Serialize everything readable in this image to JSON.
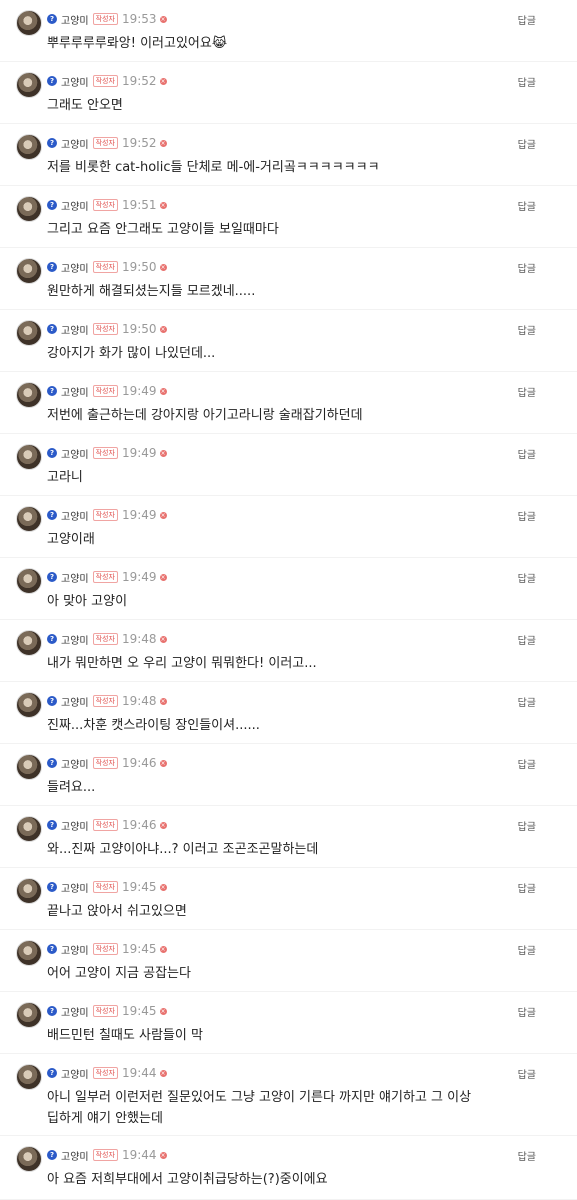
{
  "nickname": "고양미",
  "writer_badge": "작성자",
  "reply_label": "답글",
  "verified_glyph": "?",
  "delete_glyph": "×",
  "comments": [
    {
      "time": "19:53",
      "text": "뿌루루루루롸앙! 이러고있어요😹"
    },
    {
      "time": "19:52",
      "text": "그래도 안오면"
    },
    {
      "time": "19:52",
      "text": "저를 비롯한 cat-holic들 단체로 메-에-거리곸ㅋㅋㅋㅋㅋㅋㅋ"
    },
    {
      "time": "19:51",
      "text": "그리고 요즘 안그래도 고양이들 보일때마다"
    },
    {
      "time": "19:50",
      "text": "원만하게 해결되셨는지들 모르겠네....."
    },
    {
      "time": "19:50",
      "text": "강아지가 화가 많이 나있던데..."
    },
    {
      "time": "19:49",
      "text": "저번에 출근하는데 강아지랑 아기고라니랑 술래잡기하던데"
    },
    {
      "time": "19:49",
      "text": "고라니"
    },
    {
      "time": "19:49",
      "text": "고양이래"
    },
    {
      "time": "19:49",
      "text": "아 맞아 고양이"
    },
    {
      "time": "19:48",
      "text": "내가 뭐만하면 오 우리 고양이 뭐뭐한다! 이러고..."
    },
    {
      "time": "19:48",
      "text": "진짜...차훈 캣스라이팅 장인들이셔......"
    },
    {
      "time": "19:46",
      "text": "들려요..."
    },
    {
      "time": "19:46",
      "text": "와...진짜 고양이아냐...? 이러고 조곤조곤말하는데"
    },
    {
      "time": "19:45",
      "text": "끝나고 앉아서 쉬고있으면"
    },
    {
      "time": "19:45",
      "text": "어어 고양이 지금 공잡는다"
    },
    {
      "time": "19:45",
      "text": "배드민턴 칠때도 사람들이 막"
    },
    {
      "time": "19:44",
      "text": "아니 일부러 이런저런 질문있어도 그냥 고양이 기른다 까지만 얘기하고 그 이상 딥하게 얘기 안했는데"
    },
    {
      "time": "19:44",
      "text": "아 요즘 저희부대에서 고양이취급당하는(?)중이에요"
    }
  ]
}
